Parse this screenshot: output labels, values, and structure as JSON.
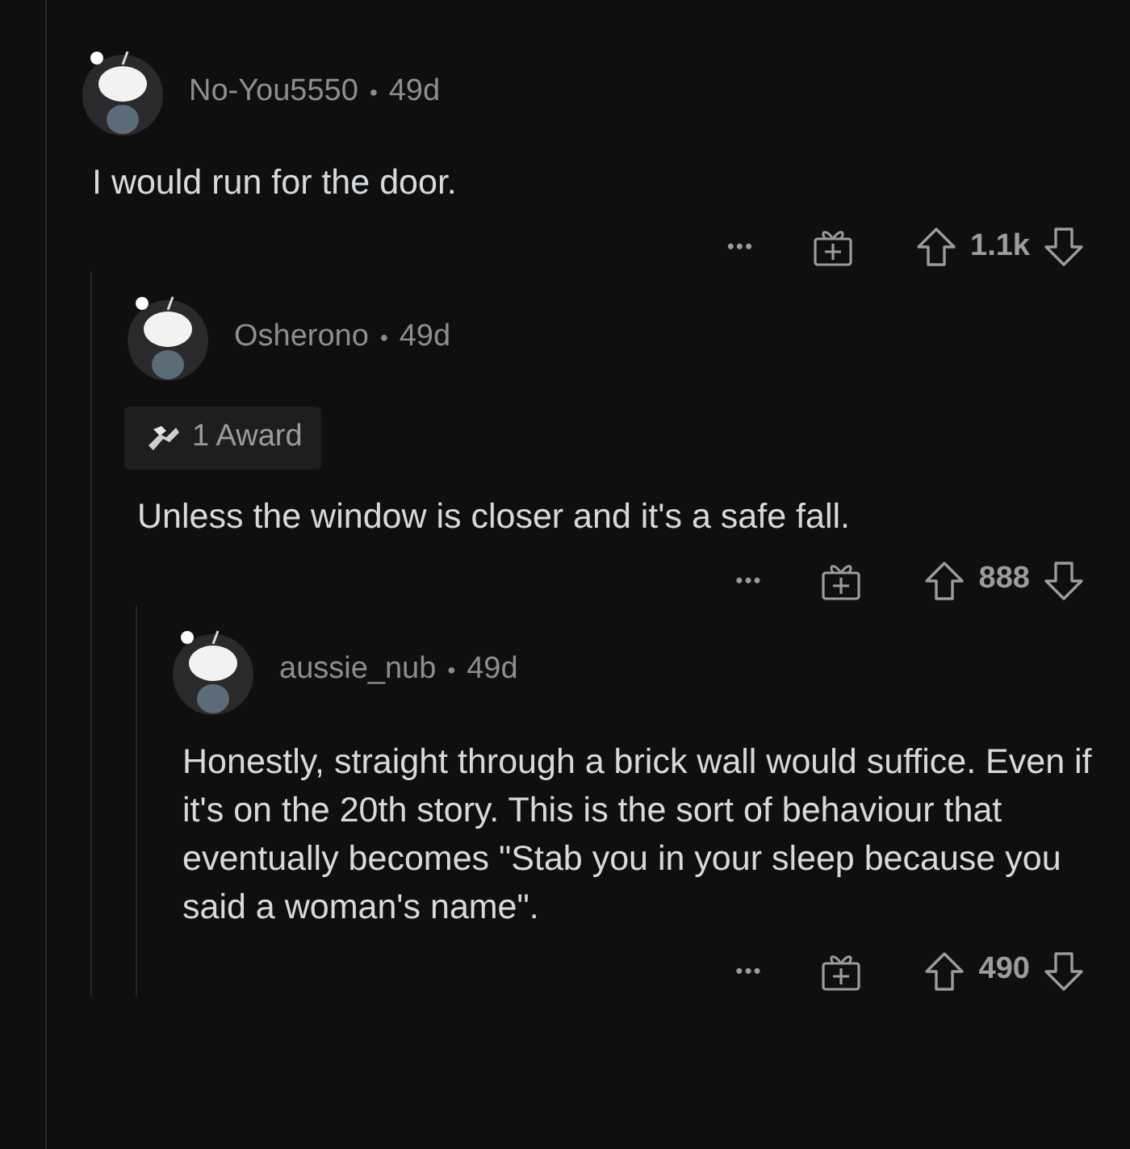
{
  "comments": [
    {
      "username": "No-You5550",
      "separator": "•",
      "age": "49d",
      "body": "I would run for the door.",
      "more": "•••",
      "votes": "1.1k",
      "children": [
        {
          "username": "Osherono",
          "separator": "•",
          "age": "49d",
          "award": "1 Award",
          "body": "Unless the window is closer and it's a safe fall.",
          "more": "•••",
          "votes": "888",
          "children": [
            {
              "username": "aussie_nub",
              "separator": "•",
              "age": "49d",
              "body": "Honestly, straight through a brick wall would suffice.  Even if it's on the 20th story.  This is the sort of behaviour that eventually becomes \"Stab you in your sleep because you said a woman's name\".",
              "more": "•••",
              "votes": "490"
            }
          ]
        }
      ]
    }
  ]
}
